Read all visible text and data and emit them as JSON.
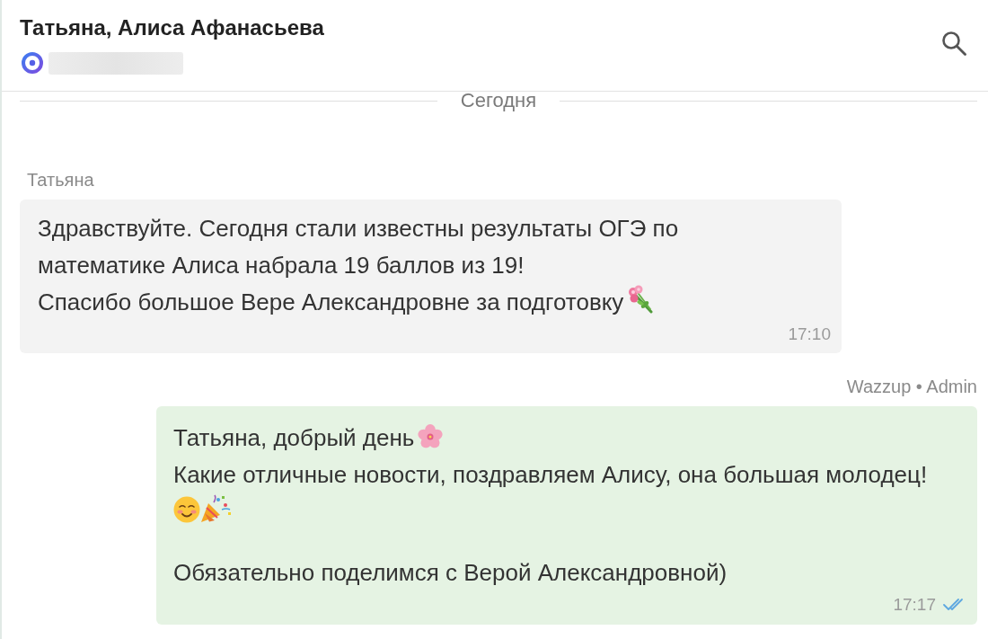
{
  "chat": {
    "title": "Татьяна, Алиса Афанасьева"
  },
  "date_divider": {
    "label": "Сегодня"
  },
  "messages": [
    {
      "kind": "incoming",
      "sender": "Татьяна",
      "lines": [
        {
          "kind": "text",
          "text": "Здравствуйте. Сегодня стали известны результаты ОГЭ по\nматематике Алиса набрала 19 баллов из 19!"
        },
        {
          "kind": "text",
          "text": "Спасибо большое Вере Александровне за подготовку",
          "emojis": [
            {
              "kind": "bouquet"
            }
          ]
        }
      ],
      "time": "17:10"
    },
    {
      "kind": "outgoing",
      "sender": "Wazzup • Admin",
      "lines": [
        {
          "kind": "text",
          "text": "Татьяна, добрый день",
          "emojis": [
            {
              "kind": "blossom"
            }
          ]
        },
        {
          "kind": "text",
          "text": "Какие отличные новости, поздравляем Алису, она большая молодец!"
        },
        {
          "kind": "text",
          "emojis": [
            {
              "kind": "smile"
            },
            {
              "kind": "party"
            }
          ]
        },
        {
          "kind": "blank"
        },
        {
          "kind": "text",
          "text": "Обязательно поделимся с Верой Александровной)"
        }
      ],
      "time": "17:17",
      "read": true
    }
  ]
}
